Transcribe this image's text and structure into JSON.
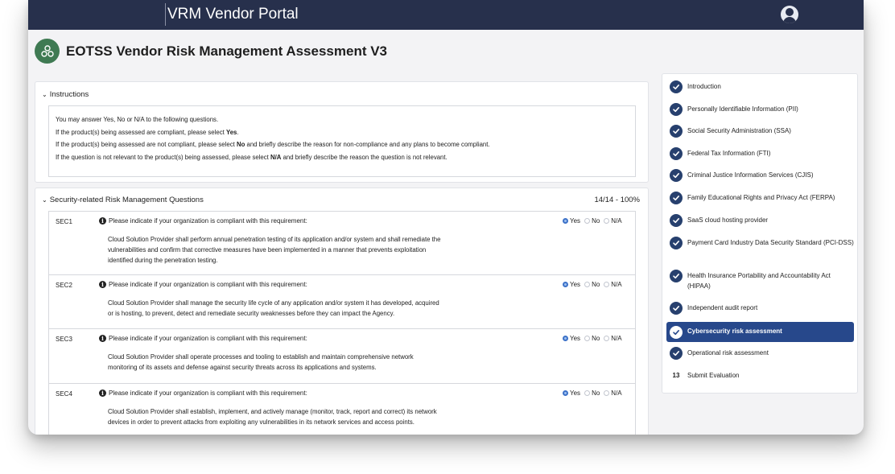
{
  "header": {
    "app_title": "VRM Vendor Portal",
    "user_icon": "user-avatar-icon"
  },
  "page": {
    "title": "EOTSS Vendor Risk Management Assessment V3",
    "logo_icon": "vendor-group-icon"
  },
  "instructions": {
    "label": "Instructions",
    "lines": [
      {
        "text": "You may answer Yes, No or N/A to the following questions."
      },
      {
        "before": "If the product(s) being assessed are compliant, please select ",
        "bold": "Yes",
        "after": "."
      },
      {
        "before": "If the product(s) being assessed are not compliant, please select ",
        "bold": "No",
        "after": " and briefly describe the reason for non-compliance and any plans to become compliant."
      },
      {
        "before": "If the question is not relevant to the product(s) being assessed, please select ",
        "bold": "N/A",
        "after": " and briefly describe the reason the question is not relevant."
      }
    ]
  },
  "questions_section": {
    "label": "Security-related Risk Management Questions",
    "progress": "14/14 - 100%",
    "options": [
      "Yes",
      "No",
      "N/A"
    ],
    "prompt": "Please indicate if your organization is compliant with this requirement:",
    "items": [
      {
        "code": "SEC1",
        "selected": "Yes",
        "lines": [
          "Cloud Solution Provider shall perform annual penetration testing of its application and/or system and shall remediate the",
          "vulnerabilities and confirm that corrective measures have been implemented in a manner that prevents exploitation",
          "identified during the penetration testing."
        ]
      },
      {
        "code": "SEC2",
        "selected": "Yes",
        "lines": [
          "Cloud Solution Provider shall manage the security life cycle of any application and/or system it has developed, acquired",
          "or is hosting, to prevent, detect and remediate security weaknesses before they can impact the Agency."
        ]
      },
      {
        "code": "SEC3",
        "selected": "Yes",
        "lines": [
          "Cloud Solution Provider shall operate processes and tooling to establish and maintain comprehensive network",
          "monitoring of its assets and defense against security threats across its applications and systems."
        ]
      },
      {
        "code": "SEC4",
        "selected": "Yes",
        "lines": [
          "Cloud Solution Provider shall establish, implement, and actively manage (monitor, track, report and correct) its network",
          "devices in order to prevent attacks from exploiting any vulnerabilities in its network services and access points."
        ]
      }
    ]
  },
  "sidebar": {
    "items": [
      {
        "label": "Introduction",
        "status": "complete"
      },
      {
        "label": "Personally Identifiable Information (PII)",
        "status": "complete"
      },
      {
        "label": "Social Security Administration (SSA)",
        "status": "complete"
      },
      {
        "label": "Federal Tax Information (FTI)",
        "status": "complete"
      },
      {
        "label": "Criminal Justice Information Services (CJIS)",
        "status": "complete"
      },
      {
        "label": "Family Educational Rights and Privacy Act (FERPA)",
        "status": "complete"
      },
      {
        "label": "SaaS cloud hosting provider",
        "status": "complete"
      },
      {
        "label": "Payment Card Industry Data Security Standard (PCI-DSS)",
        "status": "complete"
      },
      {
        "label": "Health Insurance Portability and Accountability Act (HIPAA)",
        "status": "complete"
      },
      {
        "label": "Independent audit report",
        "status": "complete"
      },
      {
        "label": "Cybersecurity risk assessment",
        "status": "complete",
        "active": true
      },
      {
        "label": "Operational risk assessment",
        "status": "complete"
      },
      {
        "label": "Submit Evaluation",
        "number": "13"
      }
    ]
  },
  "colors": {
    "topbar": "#27304c",
    "accent_active": "#27488b",
    "check": "#27406e",
    "logo": "#3f7a53"
  }
}
